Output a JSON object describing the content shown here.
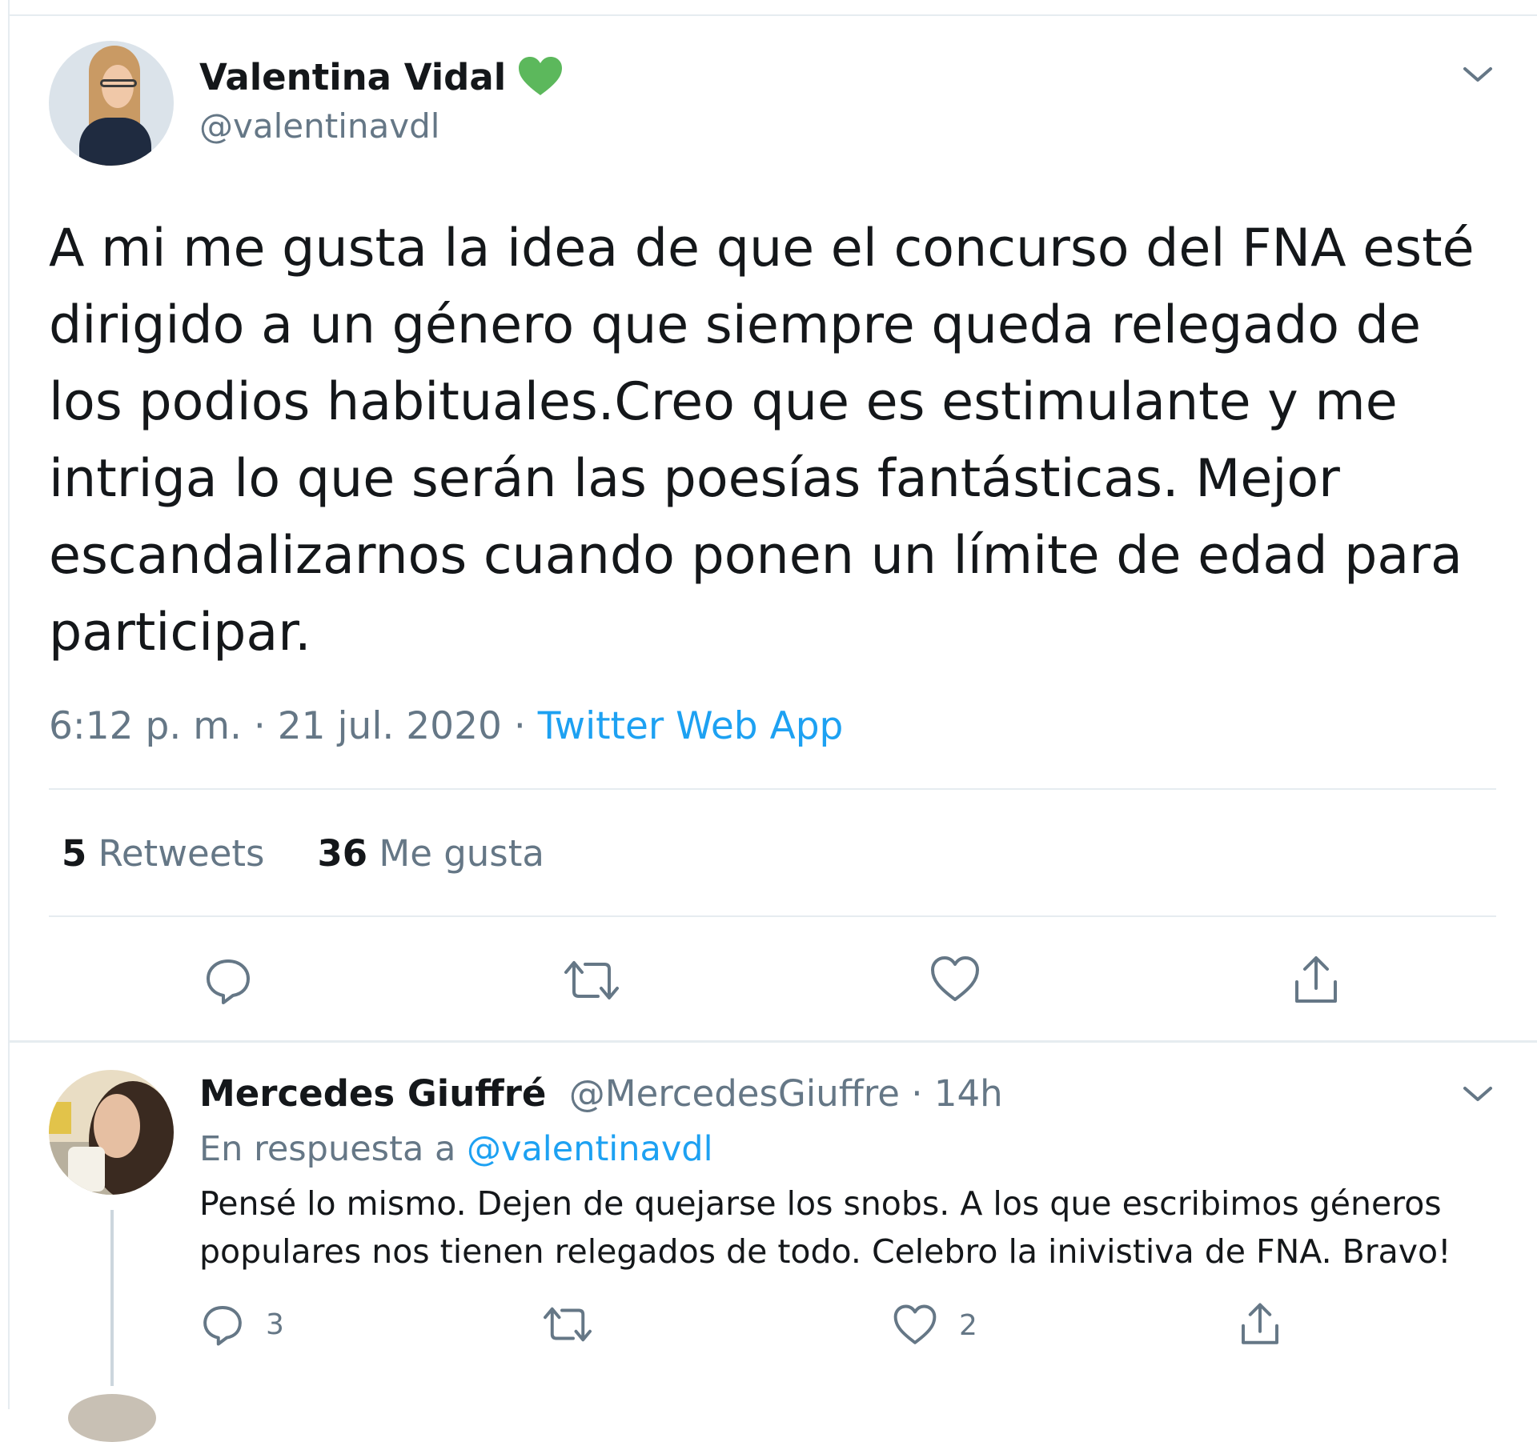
{
  "tweet": {
    "author_name": "Valentina Vidal",
    "author_handle": "@valentinavdl",
    "text": "A mi me gusta la idea de que el concurso del FNA esté\ndirigido a un género que siempre queda relegado de\nlos podios habituales.Creo que es estimulante y me\nintriga lo que serán las poesías fantásticas. Mejor\nescandalizarnos cuando ponen un límite de edad para\nparticipar.",
    "timestamp": "6:12 p. m. · 21 jul. 2020 · ",
    "source": "Twitter Web App",
    "retweets_count": "5",
    "retweets_label": "Retweets",
    "likes_count": "36",
    "likes_label": "Me gusta",
    "badge_color": "#5cb85c"
  },
  "reply": {
    "author_name": "Mercedes Giuffré",
    "author_handle_time": "@MercedesGiuffre · 14h",
    "in_reply_prefix": "En respuesta a ",
    "in_reply_mention": "@valentinavdl",
    "text": "Pensé lo mismo. Dejen de quejarse los snobs. A los que escribimos géneros\npopulares nos tienen relegados de todo. Celebro la inivistiva de FNA. Bravo!",
    "reply_count": "3",
    "like_count": "2"
  },
  "colors": {
    "link": "#1da1f2",
    "muted": "#657786",
    "text": "#14171a",
    "divider": "#e6ecf0"
  },
  "icons": [
    "chevron-down-icon",
    "heart-badge-icon",
    "reply-icon",
    "retweet-icon",
    "like-icon",
    "share-icon"
  ]
}
